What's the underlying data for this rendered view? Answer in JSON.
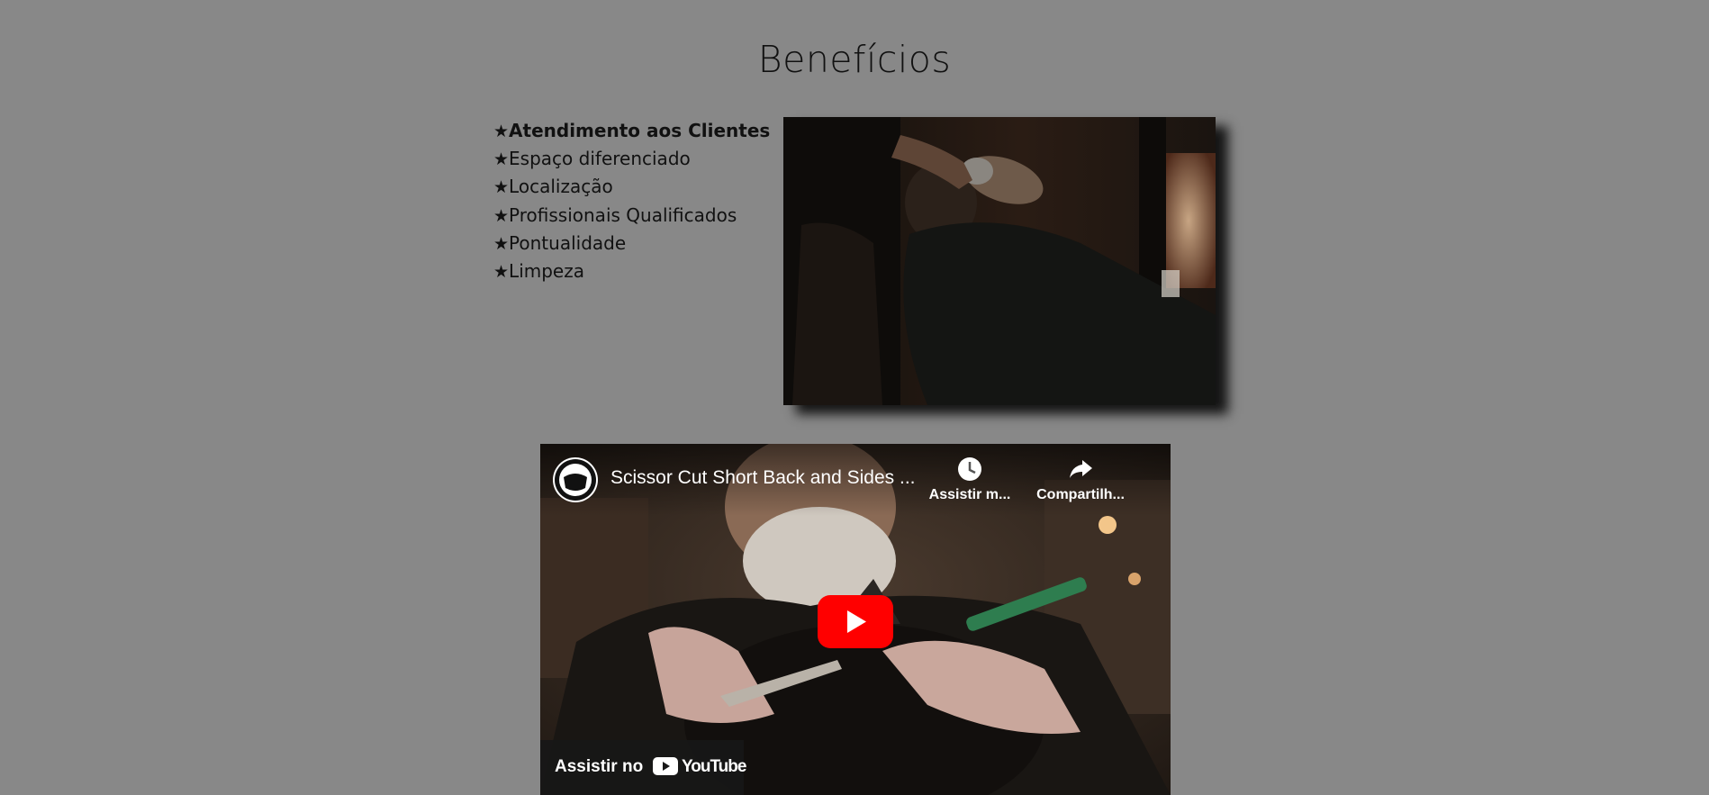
{
  "section": {
    "title": "Benefícios"
  },
  "benefits": {
    "star": "★",
    "items": [
      "Atendimento aos Clientes",
      "Espaço diferenciado",
      "Localização",
      "Profissionais Qualificados",
      "Pontualidade",
      "Limpeza"
    ]
  },
  "photo": {
    "icon": "barber-photo"
  },
  "video": {
    "title": "Scissor Cut Short Back and Sides ...",
    "watch_later_label": "Assistir m...",
    "share_label": "Compartilh...",
    "watch_on_label": "Assistir no",
    "youtube_label": "YouTube",
    "play_color": "#ff0000"
  }
}
